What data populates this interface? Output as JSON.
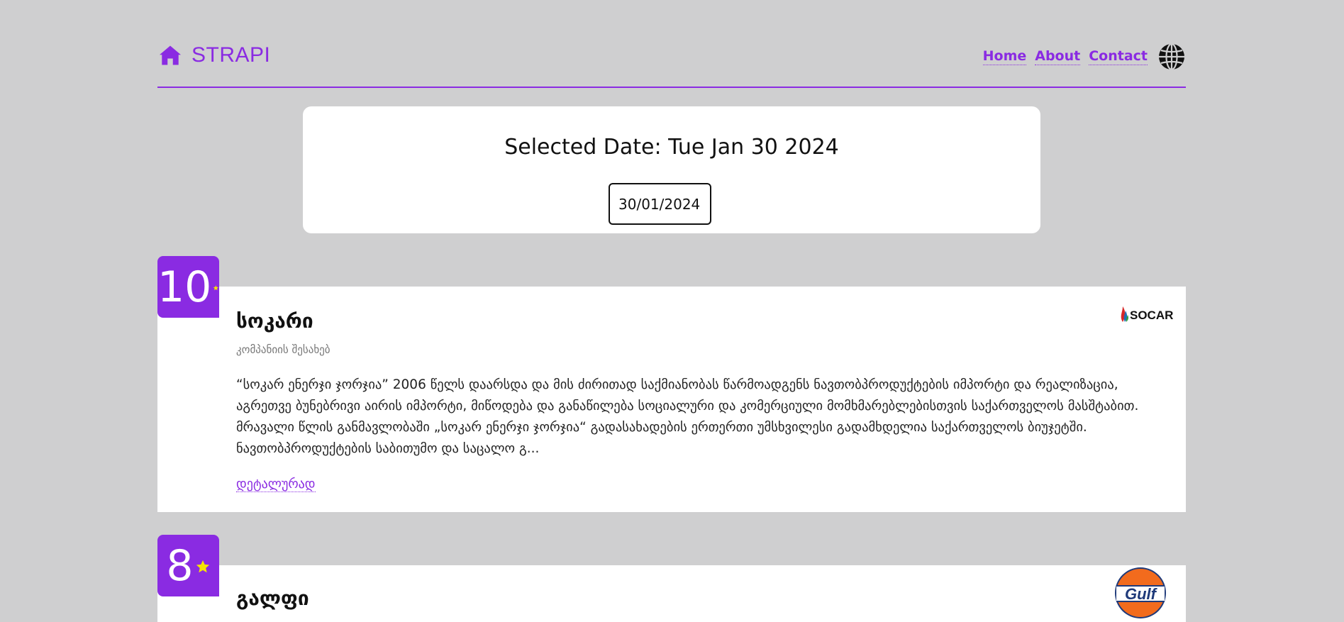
{
  "header": {
    "brand_icon": "home-icon",
    "brand": "STRAPI",
    "nav": [
      "Home",
      "About",
      "Contact"
    ],
    "language_icon": "globe-icon"
  },
  "date_picker": {
    "title": "Selected Date: Tue Jan 30 2024",
    "value": "30/01/2024",
    "icon": "calendar-icon"
  },
  "companies": [
    {
      "rating": "10",
      "name": "სოკარი",
      "subtitle": "კომპანიის შესახებ",
      "description": "“სოკარ ენერჯი ჯორჯია” 2006 წელს დაარსდა და მის ძირითად საქმიანობას წარმოადგენს ნავთობპროდუქტების იმპორტი და რეალიზაცია, აგრეთვე ბუნებრივი აირის იმპორტი, მიწოდება და განაწილება სოციალური და კომერციული მომხმარებლებისთვის საქართველოს მასშტაბით. მრავალი წლის განმავლობაში „სოკარ ენერჯი ჯორჯია“ გადასახადების ერთერთი უმსხვილესი გადამხდელია საქართველოს ბიუჯეტში. ნავთობპროდუქტების საბითუმო და საცალო გ...",
      "link": "დეტალურად",
      "logo_text": "SOCAR"
    },
    {
      "rating": "8",
      "name": "გალფი",
      "logo_text": "Gulf"
    }
  ],
  "colors": {
    "accent": "#8a2be2",
    "background": "#cfcfd0",
    "star": "#f5e400"
  }
}
